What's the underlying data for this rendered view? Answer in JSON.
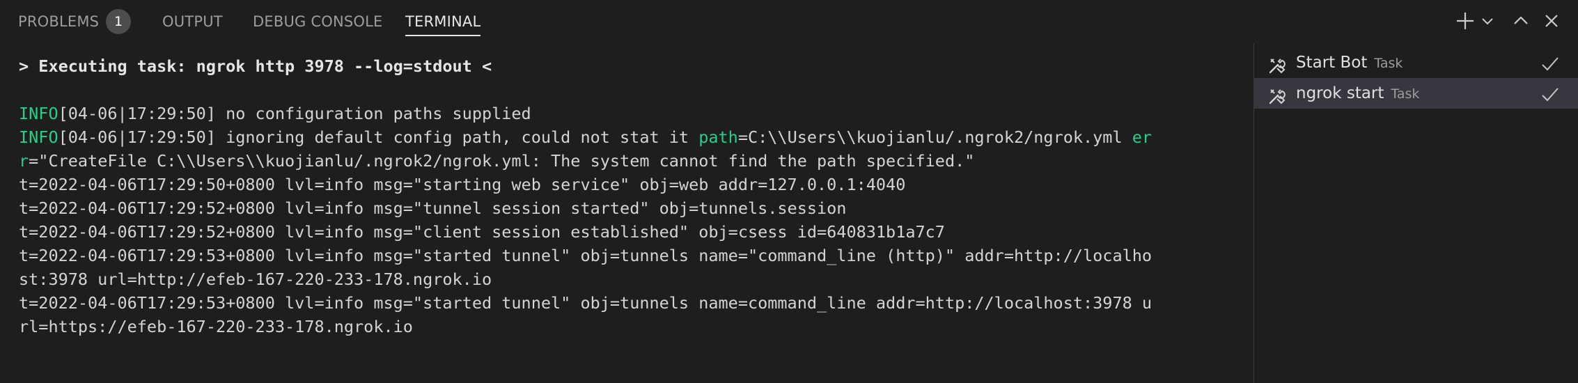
{
  "tabs": [
    {
      "label": "PROBLEMS",
      "active": false
    },
    {
      "label": "OUTPUT",
      "active": false
    },
    {
      "label": "DEBUG CONSOLE",
      "active": false
    },
    {
      "label": "TERMINAL",
      "active": true
    }
  ],
  "problems_count": "1",
  "toolbar_icons": [
    "plus-icon",
    "chevron-down-icon",
    "chevron-up-icon",
    "close-icon"
  ],
  "terminal": {
    "command": "> Executing task: ngrok http 3978 --log=stdout <",
    "line1": {
      "level": "INFO",
      "text": "[04-06|17:29:50] no configuration paths supplied"
    },
    "line2": {
      "level": "INFO",
      "text": "[04-06|17:29:50] ignoring default config path, could not stat it ",
      "key1": "path",
      "val1": "=C:\\\\Users\\\\kuojianlu/.ngrok2/ngrok.yml ",
      "key2a": "er"
    },
    "line3": {
      "key2b": "r",
      "text": "=\"CreateFile C:\\\\Users\\\\kuojianlu/.ngrok2/ngrok.yml: The system cannot find the path specified.\""
    },
    "lines": [
      "t=2022-04-06T17:29:50+0800 lvl=info msg=\"starting web service\" obj=web addr=127.0.0.1:4040",
      "t=2022-04-06T17:29:52+0800 lvl=info msg=\"tunnel session started\" obj=tunnels.session",
      "t=2022-04-06T17:29:52+0800 lvl=info msg=\"client session established\" obj=csess id=640831b1a7c7",
      "t=2022-04-06T17:29:53+0800 lvl=info msg=\"started tunnel\" obj=tunnels name=\"command_line (http)\" addr=http://localho",
      "st:3978 url=http://efeb-167-220-233-178.ngrok.io",
      "t=2022-04-06T17:29:53+0800 lvl=info msg=\"started tunnel\" obj=tunnels name=command_line addr=http://localhost:3978 u",
      "rl=https://efeb-167-220-233-178.ngrok.io"
    ]
  },
  "tasks": [
    {
      "name": "Start Bot",
      "kind": "Task",
      "selected": false
    },
    {
      "name": "ngrok start",
      "kind": "Task",
      "selected": true
    }
  ],
  "colors": {
    "background": "#1e1e1e",
    "log_level_green": "#23d18b",
    "selected_task": "#37373d"
  }
}
